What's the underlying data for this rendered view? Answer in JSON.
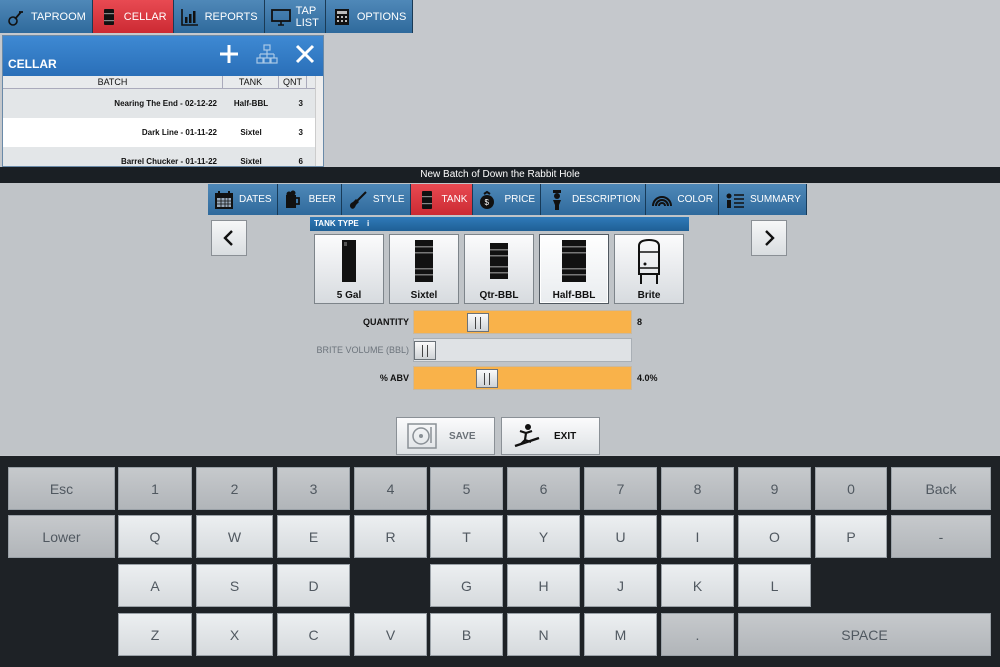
{
  "nav": {
    "items": [
      {
        "label": "TAPROOM",
        "icon": "taproom-icon",
        "active": false
      },
      {
        "label": "CELLAR",
        "icon": "keg-icon",
        "active": true
      },
      {
        "label": "REPORTS",
        "icon": "chart-icon",
        "active": false
      },
      {
        "label": "TAP LIST",
        "icon": "monitor-icon",
        "active": false
      },
      {
        "label": "OPTIONS",
        "icon": "calculator-icon",
        "active": false
      }
    ]
  },
  "cellar": {
    "title": "CELLAR",
    "columns": [
      "BATCH",
      "TANK",
      "QNT"
    ],
    "rows": [
      {
        "batch": "Nearing The End - 02-12-22",
        "tank": "Half-BBL",
        "qnt": "3"
      },
      {
        "batch": "Dark Line - 01-11-22",
        "tank": "Sixtel",
        "qnt": "3"
      },
      {
        "batch": "Barrel Chucker - 01-11-22",
        "tank": "Sixtel",
        "qnt": "6"
      }
    ]
  },
  "modal": {
    "title": "New Batch of Down the Rabbit Hole",
    "tabs": [
      {
        "label": "DATES",
        "icon": "calendar-icon"
      },
      {
        "label": "BEER",
        "icon": "beer-icon"
      },
      {
        "label": "STYLE",
        "icon": "guitar-icon"
      },
      {
        "label": "TANK",
        "icon": "keg-icon"
      },
      {
        "label": "PRICE",
        "icon": "money-bag-icon"
      },
      {
        "label": "DESCRIPTION",
        "icon": "person-icon"
      },
      {
        "label": "COLOR",
        "icon": "rainbow-icon"
      },
      {
        "label": "SUMMARY",
        "icon": "list-icon"
      }
    ],
    "active_tab": "TANK",
    "tank_type_label": "TANK TYPE",
    "tank_type_info": "i",
    "tank_options": [
      {
        "label": "5 Gal",
        "selected": false
      },
      {
        "label": "Sixtel",
        "selected": false
      },
      {
        "label": "Qtr-BBL",
        "selected": false
      },
      {
        "label": "Half-BBL",
        "selected": true
      },
      {
        "label": "Brite",
        "selected": false
      }
    ],
    "sliders": {
      "quantity": {
        "label": "QUANTITY",
        "value": "8",
        "level": 0.27
      },
      "brite_volume": {
        "label": "BRITE VOLUME (BBL)",
        "value": "",
        "level": 0.0
      },
      "abv": {
        "label": "% ABV",
        "value": "4.0%",
        "level": 0.32
      }
    },
    "save_label": "SAVE",
    "exit_label": "EXIT"
  },
  "keyboard": {
    "row1": [
      "Esc",
      "1",
      "2",
      "3",
      "4",
      "5",
      "6",
      "7",
      "8",
      "9",
      "0",
      "Back"
    ],
    "row2": [
      "Lower",
      "Q",
      "W",
      "E",
      "R",
      "T",
      "Y",
      "U",
      "I",
      "O",
      "P",
      "-"
    ],
    "row3": [
      "A",
      "S",
      "D",
      "G",
      "H",
      "J",
      "K",
      "L"
    ],
    "row4": [
      "Z",
      "X",
      "C",
      "V",
      "B",
      "N",
      "M",
      ".",
      "SPACE"
    ]
  },
  "colors": {
    "nav_blue": "#3a78ad",
    "active_red": "#d9343d",
    "slider_orange": "#f9b24a",
    "keyboard_bg": "#1e2226"
  }
}
